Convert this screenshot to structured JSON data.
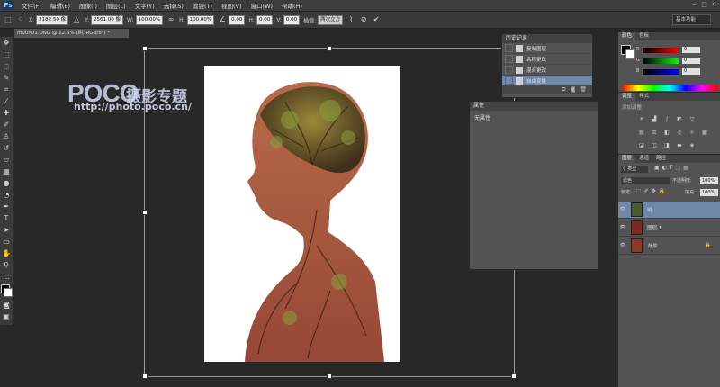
{
  "app": {
    "logo": "Ps"
  },
  "menu": [
    "文件(F)",
    "编辑(E)",
    "图像(I)",
    "图层(L)",
    "文字(Y)",
    "选择(S)",
    "滤镜(T)",
    "视图(V)",
    "窗口(W)",
    "帮助(H)"
  ],
  "options_bar": {
    "x_label": "X:",
    "x_value": "2182.50 像",
    "y_label": "Y:",
    "y_value": "2561.00 像",
    "w_label": "W:",
    "w_value": "100.00%",
    "h_label": "H:",
    "h_value": "100.00%",
    "angle_value": "0.00",
    "hskew_label": "H:",
    "hskew_value": "0.00",
    "vskew_label": "V:",
    "vskew_value": "0.00",
    "interp_label": "插值:",
    "interp_value": "两次立方",
    "workspace": "基本功能"
  },
  "document": {
    "tab_title": "mu0h01.DNG @ 12.5% (树, RGB/8*) *"
  },
  "watermark": {
    "logo": "POCO",
    "cn": "摄影专题",
    "url": "http://photo.poco.cn/"
  },
  "history": {
    "title": "历史记录",
    "items": [
      {
        "label": "复制图层",
        "selected": false
      },
      {
        "label": "名称更改",
        "selected": false
      },
      {
        "label": "混合更改",
        "selected": false
      },
      {
        "label": "自由变换",
        "selected": true
      }
    ]
  },
  "properties": {
    "title": "属性",
    "empty_text": "无属性"
  },
  "color_panel": {
    "tabs": [
      "颜色",
      "色板"
    ],
    "r": "0",
    "g": "0",
    "b": "0",
    "labels": [
      "R",
      "G",
      "B"
    ]
  },
  "adjustments": {
    "tabs": [
      "调整",
      "样式"
    ],
    "subtitle": "添加调整"
  },
  "layers": {
    "tabs": [
      "图层",
      "通道",
      "路径"
    ],
    "filter": "类型",
    "blend_mode": "滤色",
    "opacity_label": "不透明度:",
    "opacity_value": "100%",
    "lock_label": "锁定:",
    "fill_label": "填充:",
    "fill_value": "100%",
    "items": [
      {
        "name": "树",
        "selected": true,
        "thumb_color": "#4c5a2c"
      },
      {
        "name": "图层 1",
        "selected": false,
        "thumb_color": "#7a2a22"
      },
      {
        "name": "背景",
        "selected": false,
        "thumb_color": "#8a3a2a"
      }
    ]
  }
}
